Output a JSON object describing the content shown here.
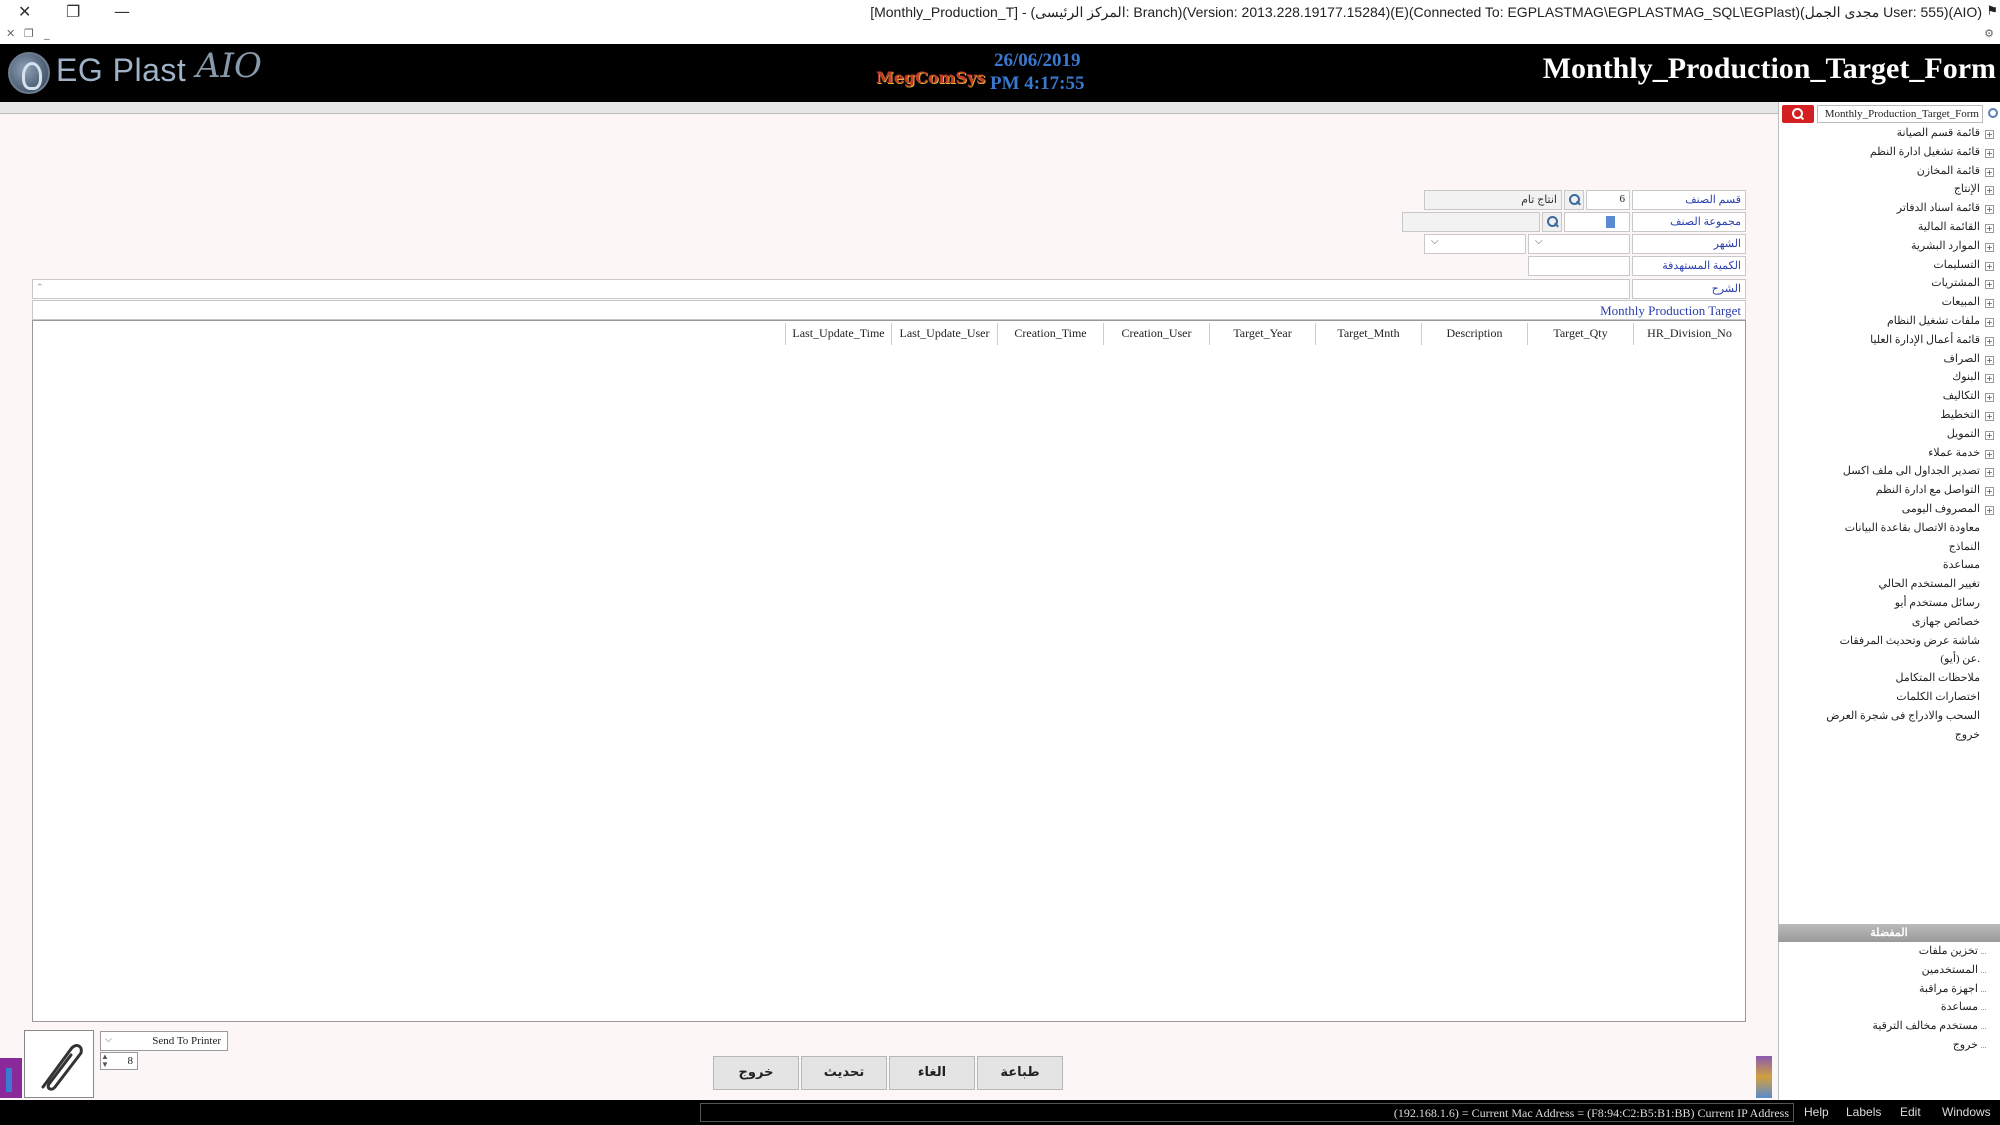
{
  "window": {
    "title": "[Monthly_Production_T] - (المركز الرئيسى: Branch)(Version: 2013.228.19177.15284)(E)(Connected To: EGPLASTMAG\\EGPLASTMAG_SQL\\EGPlast)(مجدى الجمل User: 555)(AIO)",
    "close": "✕",
    "restore": "❐",
    "minimize": "—"
  },
  "header": {
    "logo_text": "EG Plast",
    "logo_aio": "AIO",
    "brand_mid": "MegComSys",
    "date": "26/06/2019",
    "time": "PM 4:17:55",
    "form_title": "Monthly_Production_Target_Form"
  },
  "form": {
    "division_label": "قسم الصنف",
    "division_value": "6",
    "division_name": "انتاج تام",
    "group_label": "مجموعة الصنف",
    "month_label": "الشهر",
    "target_qty_label": "الكمية المستهدفة",
    "description_label": "الشرح",
    "section_title": "Monthly Production Target"
  },
  "grid": {
    "columns": [
      "HR_Division_No",
      "Target_Qty",
      "Description",
      "Target_Mnth",
      "Target_Year",
      "Creation_User",
      "Creation_Time",
      "Last_Update_User",
      "Last_Update_Time"
    ]
  },
  "bottom": {
    "printer": "Send To Printer",
    "copies": "8",
    "buttons": {
      "exit": "خروج",
      "refresh": "تحديث",
      "cancel": "الغاء",
      "print": "طباعة"
    }
  },
  "statusbar": {
    "ip": "(192.168.1.6) = Current Mac Address = (F8:94:C2:B5:B1:BB) Current IP Address",
    "menu": [
      "Help",
      "Labels",
      "Edit",
      "Windows"
    ]
  },
  "tree": {
    "search_value": "Monthly_Production_Target_Form",
    "items": [
      {
        "label": "قائمة قسم الصيانة",
        "expandable": true
      },
      {
        "label": "قائمة تشغيل ادارة النظم",
        "expandable": true
      },
      {
        "label": "قائمة المخازن",
        "expandable": true
      },
      {
        "label": "الإنتاج",
        "expandable": true
      },
      {
        "label": "قائمة اسناد الدفاتر",
        "expandable": true
      },
      {
        "label": "القائمة المالية",
        "expandable": true
      },
      {
        "label": "الموارد البشرية",
        "expandable": true
      },
      {
        "label": "التسليمات",
        "expandable": true
      },
      {
        "label": "المشتريات",
        "expandable": true
      },
      {
        "label": "المبيعات",
        "expandable": true
      },
      {
        "label": "ملفات تشغيل النظام",
        "expandable": true
      },
      {
        "label": "قائمة أعمال الإدارة العليا",
        "expandable": true
      },
      {
        "label": "الصراف",
        "expandable": true
      },
      {
        "label": "البنوك",
        "expandable": true
      },
      {
        "label": "التكاليف",
        "expandable": true
      },
      {
        "label": "التخطيط",
        "expandable": true
      },
      {
        "label": "التمويل",
        "expandable": true
      },
      {
        "label": "خدمة عملاء",
        "expandable": true
      },
      {
        "label": "تصدير الجداول الى ملف اكسل",
        "expandable": true
      },
      {
        "label": "التواصل مع ادارة النظم",
        "expandable": true
      },
      {
        "label": "المصروف اليومى",
        "expandable": true
      },
      {
        "label": "معاودة الاتصال بقاعدة البيانات",
        "expandable": false
      },
      {
        "label": "النماذج",
        "expandable": false
      },
      {
        "label": "مساعدة",
        "expandable": false
      },
      {
        "label": "تغيير المستخدم الحالي",
        "expandable": false
      },
      {
        "label": "رسائل مستخدم أيو",
        "expandable": false
      },
      {
        "label": "خصائص جهازى",
        "expandable": false
      },
      {
        "label": "شاشة عرض وتحديث المرفقات",
        "expandable": false
      },
      {
        "label": "عن (أيو).",
        "expandable": false
      },
      {
        "label": "ملاحظات المتكامل",
        "expandable": false
      },
      {
        "label": "اختصارات الكلمات",
        "expandable": false
      },
      {
        "label": "السحب والادراج فى شجرة العرض",
        "expandable": false
      },
      {
        "label": "خروج",
        "expandable": false
      }
    ],
    "favorites_title": "المفضلة",
    "favorites": [
      "تخزين ملفات",
      "المستخدمين",
      "اجهزة مراقبة",
      "مساعدة",
      "مستخدم مخالف الترقية",
      "خروج"
    ]
  }
}
